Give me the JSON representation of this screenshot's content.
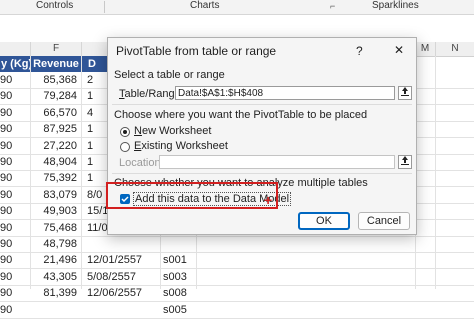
{
  "ribbon": {
    "groups": [
      "Controls",
      "Charts",
      "Sparklines"
    ]
  },
  "columns": {
    "left_partial": "y (Kg)",
    "F": "F",
    "F_header": "Revenue",
    "G_partial": "D",
    "M": "M",
    "N": "N"
  },
  "rows": [
    {
      "a": "90",
      "revenue": "85,368",
      "date": "2"
    },
    {
      "a": "90",
      "revenue": "79,284",
      "date": "1"
    },
    {
      "a": "90",
      "revenue": "66,570",
      "date": "4"
    },
    {
      "a": "90",
      "revenue": "87,925",
      "date": "1"
    },
    {
      "a": "90",
      "revenue": "27,220",
      "date": "1"
    },
    {
      "a": "90",
      "revenue": "48,904",
      "date": "1"
    },
    {
      "a": "90",
      "revenue": "75,392",
      "date": "1"
    },
    {
      "a": "90",
      "revenue": "83,079",
      "date": "8/0"
    },
    {
      "a": "90",
      "revenue": "49,903",
      "date": "15/1"
    },
    {
      "a": "90",
      "revenue": "75,468",
      "date": "11/0"
    },
    {
      "a": "90",
      "revenue": "48,798",
      "date": ""
    },
    {
      "a": "90",
      "revenue": "21,496",
      "date": "12/01/2557",
      "id": "s001"
    },
    {
      "a": "90",
      "revenue": "43,305",
      "date": "5/08/2557",
      "id": "s003"
    },
    {
      "a": "90",
      "revenue": "81,399",
      "date": "12/06/2557",
      "id": "s008"
    },
    {
      "a": "90",
      "revenue": "",
      "date": "",
      "id": "s005"
    }
  ],
  "dialog": {
    "title": "PivotTable from table or range",
    "help": "?",
    "close": "✕",
    "section1": "Select a table or range",
    "table_range_label_pre": "",
    "table_range_label_u": "T",
    "table_range_label_post": "able/Range:",
    "table_range_value": "Data!$A$1:$H$408",
    "section2": "Choose where you want the PivotTable to be placed",
    "new_ws_u": "N",
    "new_ws_rest": "ew Worksheet",
    "existing_ws_u": "E",
    "existing_ws_rest": "xisting Worksheet",
    "location_label": "Location:",
    "section3": "Choose whether you want to analyze multiple tables",
    "data_model_label": "Add this data to the Data Model",
    "ok": "OK",
    "cancel": "Cancel"
  },
  "colors": {
    "accent": "#0067c0",
    "header_fill": "#2f5597",
    "highlight": "#d21f1f"
  },
  "icons": [
    "range-picker-icon",
    "location-picker-icon",
    "checkbox-checked-icon",
    "cursor-plus-icon"
  ]
}
